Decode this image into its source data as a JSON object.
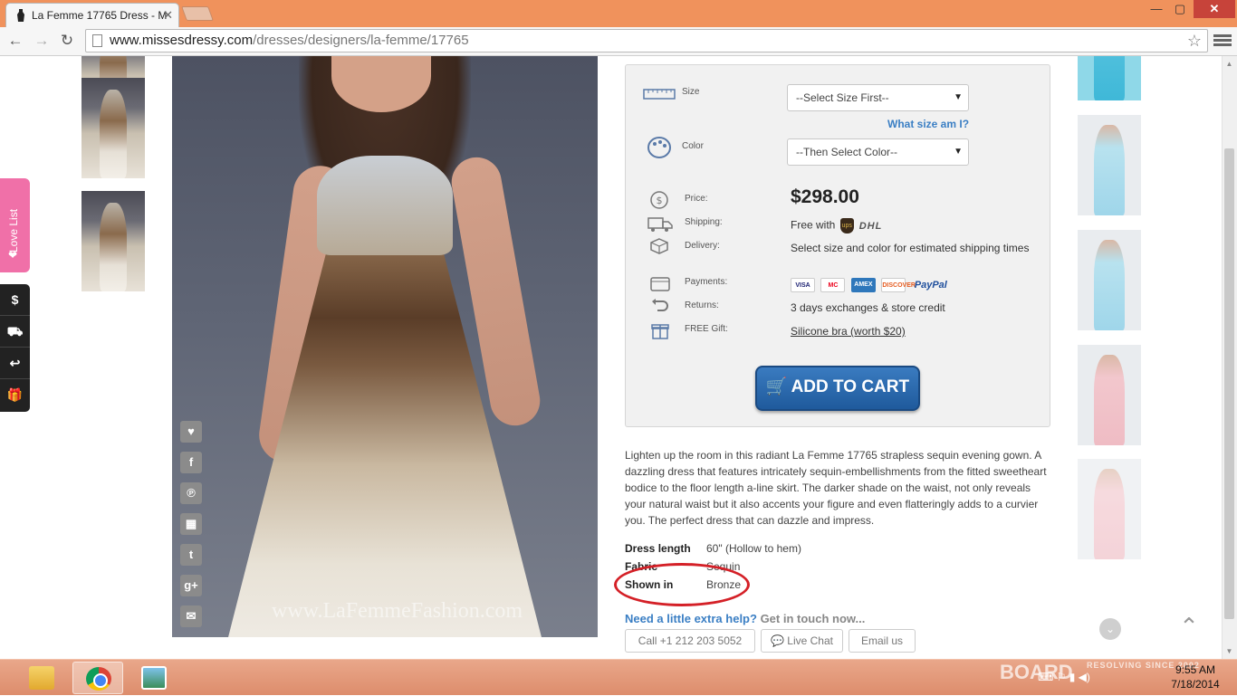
{
  "browser": {
    "tab_title": "La Femme 17765 Dress - M",
    "tab_close": "✕",
    "url_host": "www.missesdressy.com",
    "url_path": "/dresses/designers/la-femme/17765",
    "minimize": "—",
    "maximize": "▢",
    "close": "✕",
    "back": "←",
    "forward": "→",
    "reload": "↻",
    "bookmark": "☆"
  },
  "left_widgets": {
    "love_list": "Love List",
    "heart": "❤",
    "quick_buttons": [
      "$",
      "⛟",
      "↩",
      "🎁"
    ]
  },
  "product_photo": {
    "watermark": "www.LaFemmeFashion.com"
  },
  "social_buttons": [
    "♥",
    "f",
    "℗",
    "▦",
    "t",
    "g+",
    "✉"
  ],
  "buy_panel": {
    "size_label": "Size",
    "size_select": "--Select Size First--",
    "size_help": "What size am I?",
    "color_label": "Color",
    "color_select": "--Then Select Color--",
    "price_label": "Price:",
    "price": "$298.00",
    "shipping_label": "Shipping:",
    "shipping_value": "Free with",
    "ups": "ups",
    "dhl": "DHL",
    "delivery_label": "Delivery:",
    "delivery_value": "Select size and color for estimated shipping times",
    "payments_label": "Payments:",
    "cards": [
      "VISA",
      "MC",
      "AMEX",
      "DISCOVER",
      "PayPal"
    ],
    "returns_label": "Returns:",
    "returns_value": "3 days exchanges & store credit",
    "gift_label": "FREE Gift:",
    "gift_value": "Silicone bra (worth $20)",
    "add_to_cart": "ADD TO CART"
  },
  "description": "Lighten up the room in this radiant La Femme 17765 strapless sequin evening gown. A dazzling dress that features intricately sequin-embellishments from the fitted sweetheart bodice to the floor length a-line skirt. The darker shade on the waist, not only reveals your natural waist but it also accents your figure and even flatteringly adds to a curvier you. The perfect dress that can dazzle and impress.",
  "specs": [
    {
      "label": "Dress length",
      "value": "60\" (Hollow to hem)"
    },
    {
      "label": "Fabric",
      "value": "Sequin"
    },
    {
      "label": "Shown in",
      "value": "Bronze"
    }
  ],
  "help": {
    "title": "Need a little extra help?",
    "subtitle": "Get in touch now...",
    "call": "Call +1 212 203 5052",
    "chat": "Live Chat",
    "email": "Email us"
  },
  "taskbar": {
    "brand": "BOARD",
    "brand_sub": "RESOLVING SINCE 2002",
    "tray": "⌨ ⚐ ▮ ◀)",
    "time": "9:55 AM",
    "date": "7/18/2014"
  },
  "colors": {
    "titlebar": "#f0925c",
    "accent_blue": "#3b7fc4",
    "cart_button": "#1f5a9c",
    "love_list": "#f070a8",
    "highlight": "#d42027"
  }
}
